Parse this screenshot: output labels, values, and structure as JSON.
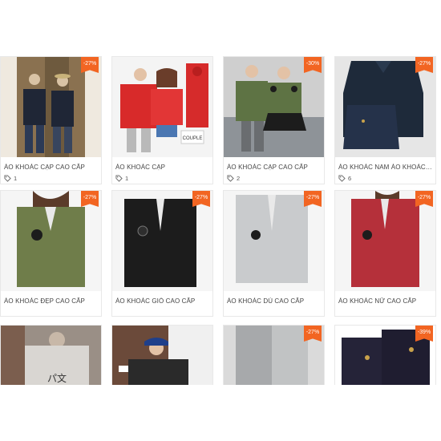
{
  "products": [
    {
      "title": "ÁO KHOÁC CẠP CAO CẤP",
      "discount": "-27%",
      "likes": "1",
      "colors": {
        "bg": "#8a7150",
        "item": "#1f2636"
      }
    },
    {
      "title": "ÁO KHOÁC CẠP",
      "discount": "",
      "likes": "1",
      "colors": {
        "bg": "#f4f4f4",
        "item": "#d82a2a"
      },
      "img_text": "COUPLE"
    },
    {
      "title": "ÁO KHOÁC CẠP CAO CẤP",
      "discount": "-30%",
      "likes": "2",
      "colors": {
        "bg": "#cfcfcf",
        "item": "#5e7344"
      }
    },
    {
      "title": "ÁO KHOÁC NAM ÁO KHOÁC N...",
      "discount": "-27%",
      "likes": "6",
      "colors": {
        "bg": "#e6e6e6",
        "item": "#1e2a3a"
      }
    },
    {
      "title": "ÁO KHOÁC ĐẸP CAO CẤP",
      "discount": "-27%",
      "likes": "",
      "colors": {
        "bg": "#f5f5f5",
        "item": "#6f7d4a"
      }
    },
    {
      "title": "ÁO KHOÁC GIÓ CAO CẤP",
      "discount": "-27%",
      "likes": "",
      "colors": {
        "bg": "#f5f5f5",
        "item": "#1c1c1c"
      }
    },
    {
      "title": "ÁO KHOÁC DÙ CAO CẤP",
      "discount": "-27%",
      "likes": "",
      "colors": {
        "bg": "#f5f5f5",
        "item": "#c9cbcd"
      }
    },
    {
      "title": "ÁO KHOÁC NỮ CAO CẤP",
      "discount": "-27%",
      "likes": "",
      "colors": {
        "bg": "#f5f5f5",
        "item": "#b5303a"
      }
    },
    {
      "title": "",
      "discount": "",
      "likes": "",
      "colors": {
        "bg": "#9a8f86",
        "item": "#d9d6d2"
      },
      "img_text": "パ文"
    },
    {
      "title": "",
      "discount": "",
      "likes": "",
      "colors": {
        "bg": "#6b4a3a",
        "item": "#2a2a2a"
      }
    },
    {
      "title": "",
      "discount": "-27%",
      "likes": "",
      "colors": {
        "bg": "#dadada",
        "item": "#a7a9ab"
      }
    },
    {
      "title": "",
      "discount": "-39%",
      "likes": "",
      "colors": {
        "bg": "#ffffff",
        "item": "#252338"
      }
    }
  ],
  "accent": "#f26522"
}
